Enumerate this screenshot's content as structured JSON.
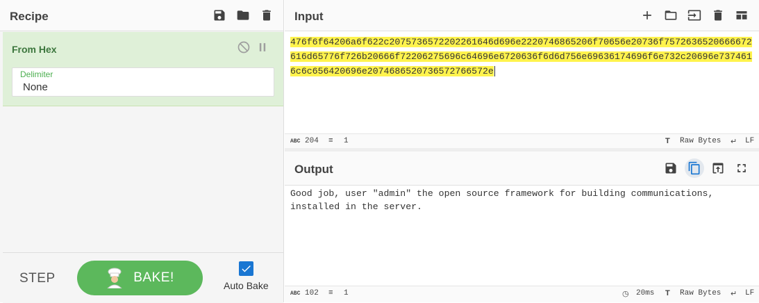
{
  "recipe": {
    "title": "Recipe",
    "operation": {
      "name": "From Hex",
      "delimiter_label": "Delimiter",
      "delimiter_value": "None"
    },
    "step_label": "STEP",
    "bake_label": "BAKE!",
    "auto_bake_label": "Auto Bake",
    "auto_bake_checked": true
  },
  "input": {
    "title": "Input",
    "text": "476f6f64206a6f622c2075736572202261646d696e2220746865206f70656e20736f7572636520666672616d65776f726b20666f72206275696c64696e6720636f6d6d756e69636174696f6e732c20696e7374616c6c656420696e2074686520736572766572e",
    "status_length": "204",
    "status_lines": "1",
    "status_encoding": "Raw Bytes",
    "status_eol": "LF"
  },
  "output": {
    "title": "Output",
    "text_line1": "Good job, user \"admin\" the open source framework for building communications,",
    "text_line2": "installed in the server.",
    "status_length": "102",
    "status_lines": "1",
    "status_time": "20ms",
    "status_encoding": "Raw Bytes",
    "status_eol": "LF"
  },
  "icons": {
    "save": "save-icon",
    "open": "folder-icon",
    "delete": "trash-icon",
    "add": "plus-icon",
    "disable": "disable-icon",
    "pause": "pause-icon",
    "copy": "copy-icon",
    "replace_input": "replace-input-icon",
    "maximise": "maximise-icon"
  },
  "colors": {
    "operation_bg": "#dff0d8",
    "operation_title": "#3c763d",
    "bake_button": "#5cb85c",
    "highlight": "#fff34d",
    "checkbox": "#1976d2"
  }
}
